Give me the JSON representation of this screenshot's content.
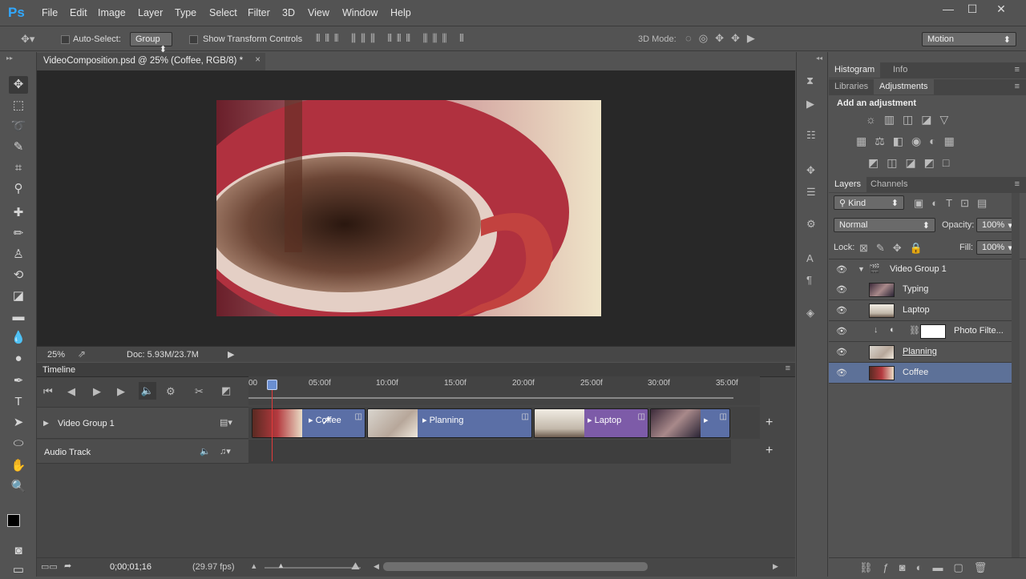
{
  "app": {
    "logo": "Ps"
  },
  "menu": [
    "File",
    "Edit",
    "Image",
    "Layer",
    "Type",
    "Select",
    "Filter",
    "3D",
    "View",
    "Window",
    "Help"
  ],
  "window_controls": {
    "minimize": "—",
    "maximize": "☐",
    "close": "✕"
  },
  "options": {
    "auto_select_label": "Auto-Select:",
    "auto_select_value": "Group",
    "show_transform_label": "Show Transform Controls",
    "mode_3d_label": "3D Mode:",
    "workspace_value": "Motion"
  },
  "document": {
    "tab_title": "VideoComposition.psd @ 25% (Coffee, RGB/8) *",
    "close": "×",
    "zoom": "25%",
    "doc_info": "Doc: 5.93M/23.7M"
  },
  "timeline": {
    "title": "Timeline",
    "ruler": [
      "00",
      "05:00f",
      "10:00f",
      "15:00f",
      "20:00f",
      "25:00f",
      "30:00f",
      "35:00f"
    ],
    "tracks": [
      {
        "name": "Video Group 1"
      },
      {
        "name": "Audio Track"
      }
    ],
    "clips": [
      {
        "label": "Coffee"
      },
      {
        "label": "Planning"
      },
      {
        "label": "Laptop"
      },
      {
        "label": ""
      }
    ],
    "timecode": "0;00;01;16",
    "fps": "(29.97 fps)"
  },
  "panels": {
    "top_tabs": [
      "Histogram",
      "Info"
    ],
    "second_tabs": [
      "Libraries",
      "Adjustments"
    ],
    "adjust_title": "Add an adjustment",
    "layers_tabs": [
      "Layers",
      "Channels"
    ],
    "kind_label": "Kind",
    "blend_mode": "Normal",
    "opacity_label": "Opacity:",
    "opacity_value": "100%",
    "lock_label": "Lock:",
    "fill_label": "Fill:",
    "fill_value": "100%"
  },
  "layers": [
    {
      "name": "Video Group 1"
    },
    {
      "name": "Typing"
    },
    {
      "name": "Laptop"
    },
    {
      "name": "Photo Filte..."
    },
    {
      "name": "Planning"
    },
    {
      "name": "Coffee"
    }
  ],
  "colors": {
    "accent": "#31a8ff",
    "clip_blue": "#5b6fa6",
    "clip_purple": "#7d5ba8",
    "playhead": "#e33a3a",
    "selected_layer": "#5d7198"
  }
}
